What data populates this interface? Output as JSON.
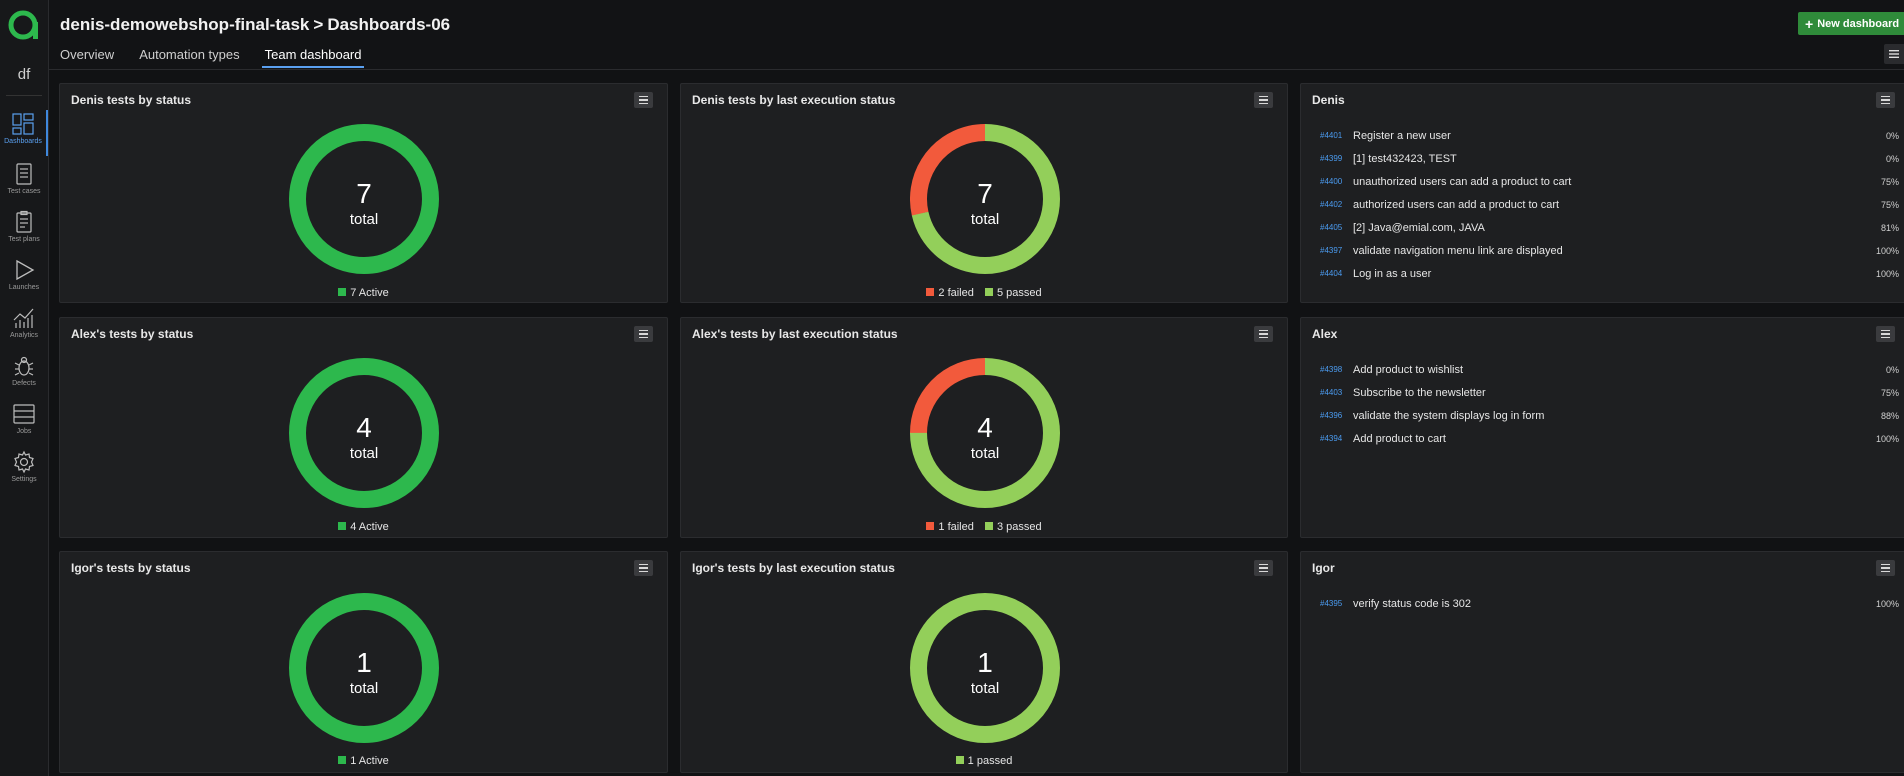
{
  "sidebar": {
    "project_abbr": "df",
    "items": [
      {
        "label": "Dashboards",
        "icon": "dashboards-icon",
        "active": true
      },
      {
        "label": "Test cases",
        "icon": "test-cases-icon"
      },
      {
        "label": "Test plans",
        "icon": "test-plans-icon"
      },
      {
        "label": "Launches",
        "icon": "launches-icon"
      },
      {
        "label": "Analytics",
        "icon": "analytics-icon"
      },
      {
        "label": "Defects",
        "icon": "defects-icon"
      },
      {
        "label": "Jobs",
        "icon": "jobs-icon"
      },
      {
        "label": "Settings",
        "icon": "settings-icon"
      }
    ]
  },
  "header": {
    "project": "denis-demowebshop-final-task",
    "separator": ">",
    "dashboard": "Dashboards-06",
    "tabs": [
      "Overview",
      "Automation types",
      "Team dashboard"
    ],
    "active_tab": "Team dashboard",
    "new_dashboard_label": "New dashboard",
    "new_dashboard_icon": "+"
  },
  "colors": {
    "active": "#2db84d",
    "failed": "#f25a3c",
    "passed": "#93cf5a",
    "link": "#4b9bf0"
  },
  "widgets": {
    "denis_status": {
      "title": "Denis tests by status",
      "total": "7",
      "total_label": "total",
      "legend": [
        {
          "label": "7 Active",
          "value": 7
        }
      ]
    },
    "denis_exec": {
      "title": "Denis tests by last execution status",
      "total": "7",
      "total_label": "total",
      "legend": [
        {
          "label": "2 failed",
          "value": 2
        },
        {
          "label": "5 passed",
          "value": 5
        }
      ]
    },
    "denis_list": {
      "title": "Denis",
      "rows": [
        {
          "id": "#4401",
          "name": "Register a new user",
          "pct": "0%"
        },
        {
          "id": "#4399",
          "name": "[1] test432423, TEST",
          "pct": "0%"
        },
        {
          "id": "#4400",
          "name": "unauthorized users can add a product to cart",
          "pct": "75%"
        },
        {
          "id": "#4402",
          "name": "authorized users can add a product to cart",
          "pct": "75%"
        },
        {
          "id": "#4405",
          "name": "[2] Java@emial.com, JAVA",
          "pct": "81%"
        },
        {
          "id": "#4397",
          "name": "validate navigation menu link are displayed",
          "pct": "100%"
        },
        {
          "id": "#4404",
          "name": "Log in as a user",
          "pct": "100%"
        }
      ]
    },
    "alex_status": {
      "title": "Alex's tests by status",
      "total": "4",
      "total_label": "total",
      "legend": [
        {
          "label": "4 Active",
          "value": 4
        }
      ]
    },
    "alex_exec": {
      "title": "Alex's tests by last execution status",
      "total": "4",
      "total_label": "total",
      "legend": [
        {
          "label": "1 failed",
          "value": 1
        },
        {
          "label": "3 passed",
          "value": 3
        }
      ]
    },
    "alex_list": {
      "title": "Alex",
      "rows": [
        {
          "id": "#4398",
          "name": "Add product to wishlist",
          "pct": "0%"
        },
        {
          "id": "#4403",
          "name": "Subscribe to the newsletter",
          "pct": "75%"
        },
        {
          "id": "#4396",
          "name": "validate the system displays log in form",
          "pct": "88%"
        },
        {
          "id": "#4394",
          "name": "Add product to cart",
          "pct": "100%"
        }
      ]
    },
    "igor_status": {
      "title": "Igor's tests by status",
      "total": "1",
      "total_label": "total",
      "legend": [
        {
          "label": "1 Active",
          "value": 1
        }
      ]
    },
    "igor_exec": {
      "title": "Igor's tests by last execution status",
      "total": "1",
      "total_label": "total",
      "legend": [
        {
          "label": "1 passed",
          "value": 1
        }
      ]
    },
    "igor_list": {
      "title": "Igor",
      "rows": [
        {
          "id": "#4395",
          "name": "verify status code is 302",
          "pct": "100%"
        }
      ]
    }
  }
}
